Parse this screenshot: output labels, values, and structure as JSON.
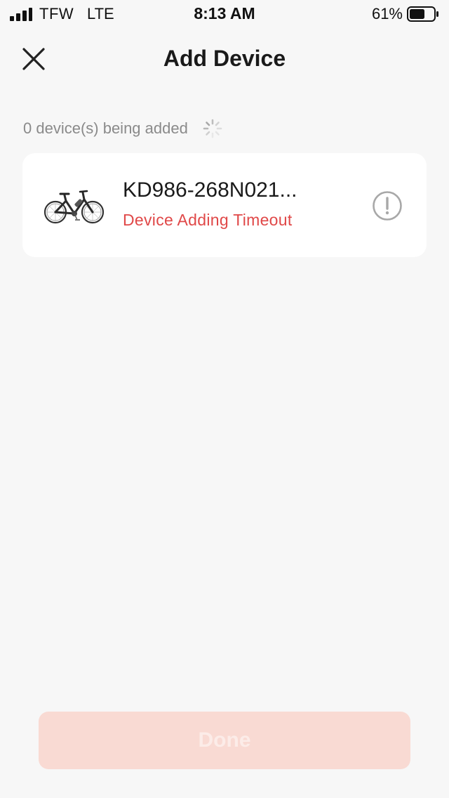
{
  "status_bar": {
    "carrier": "TFW",
    "network": "LTE",
    "time": "8:13 AM",
    "battery_percent": "61%",
    "battery_level": 0.61
  },
  "nav": {
    "title": "Add Device",
    "close_icon": "close-icon"
  },
  "section": {
    "count_label": "0 device(s) being added",
    "spinner_icon": "loading-spinner-icon"
  },
  "devices": [
    {
      "name": "KD986-268N021...",
      "status": "Device Adding Timeout",
      "status_color": "#e04848",
      "image": "electric-bike-icon",
      "action_icon": "alert-circle-icon"
    }
  ],
  "footer": {
    "done_label": "Done",
    "done_enabled": false
  },
  "colors": {
    "background": "#f7f7f7",
    "card": "#ffffff",
    "accent_disabled": "#f9dad3",
    "error": "#e04848"
  }
}
